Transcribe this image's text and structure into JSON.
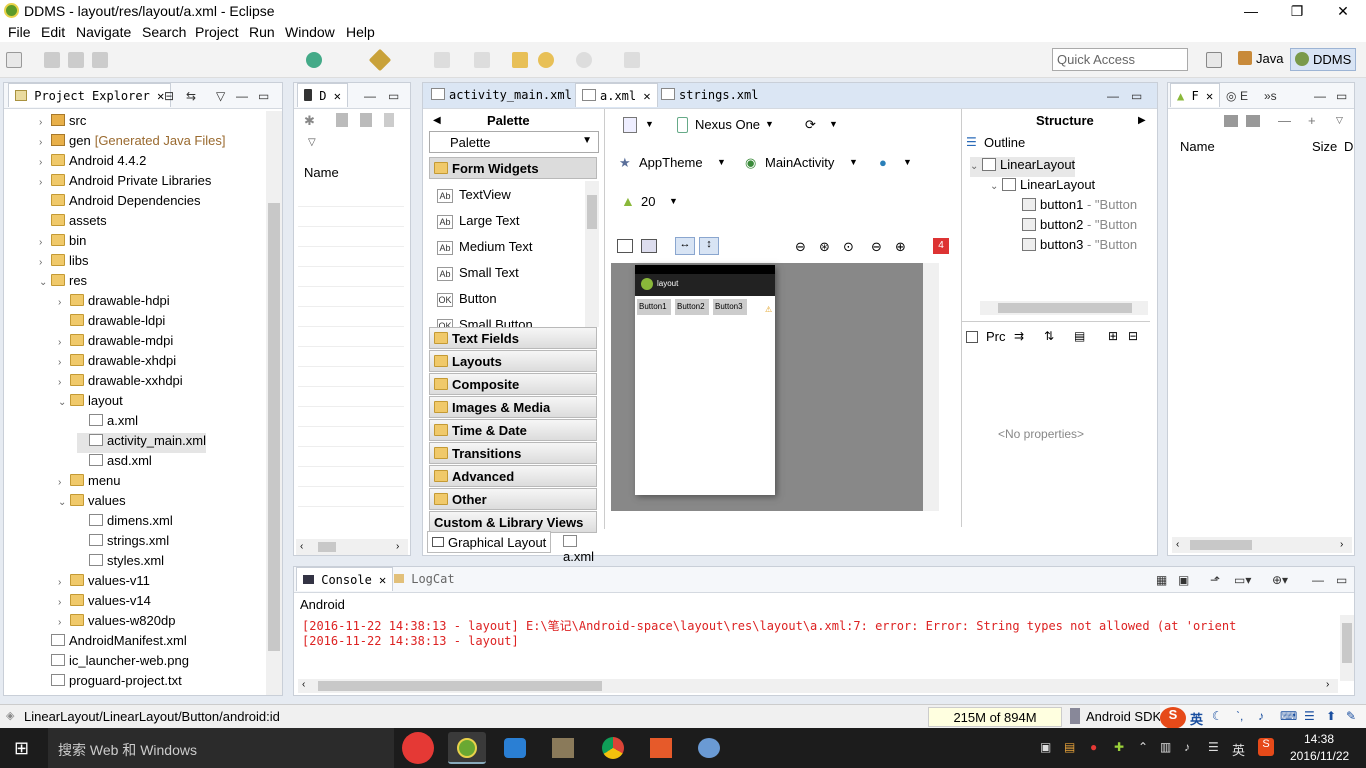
{
  "window": {
    "title": "DDMS - layout/res/layout/a.xml - Eclipse",
    "min": "—",
    "max": "❐",
    "close": "✕"
  },
  "menu": [
    "File",
    "Edit",
    "Navigate",
    "Search",
    "Project",
    "Run",
    "Window",
    "Help"
  ],
  "quick_access": {
    "placeholder": "Quick Access"
  },
  "perspectives": {
    "java": "Java",
    "ddms": "DDMS"
  },
  "project_explorer": {
    "tab": "Project Explorer",
    "items": [
      {
        "label": "src",
        "depth": 1,
        "type": "pkg",
        "open": false
      },
      {
        "label": "gen",
        "extra": "[Generated Java Files]",
        "depth": 1,
        "type": "pkg",
        "open": false
      },
      {
        "label": "Android 4.4.2",
        "depth": 1,
        "type": "lib",
        "open": false
      },
      {
        "label": "Android Private Libraries",
        "depth": 1,
        "type": "lib",
        "open": false
      },
      {
        "label": "Android Dependencies",
        "depth": 1,
        "type": "lib",
        "open": null
      },
      {
        "label": "assets",
        "depth": 1,
        "type": "folder",
        "open": null
      },
      {
        "label": "bin",
        "depth": 1,
        "type": "folder",
        "open": false
      },
      {
        "label": "libs",
        "depth": 1,
        "type": "folder",
        "open": false
      },
      {
        "label": "res",
        "depth": 1,
        "type": "folder",
        "open": true
      },
      {
        "label": "drawable-hdpi",
        "depth": 2,
        "type": "folder",
        "open": false
      },
      {
        "label": "drawable-ldpi",
        "depth": 2,
        "type": "folder",
        "open": null
      },
      {
        "label": "drawable-mdpi",
        "depth": 2,
        "type": "folder",
        "open": false
      },
      {
        "label": "drawable-xhdpi",
        "depth": 2,
        "type": "folder",
        "open": false
      },
      {
        "label": "drawable-xxhdpi",
        "depth": 2,
        "type": "folder",
        "open": false
      },
      {
        "label": "layout",
        "depth": 2,
        "type": "folder",
        "open": true
      },
      {
        "label": "a.xml",
        "depth": 3,
        "type": "file",
        "open": null
      },
      {
        "label": "activity_main.xml",
        "depth": 3,
        "type": "file",
        "open": null,
        "selected": true
      },
      {
        "label": "asd.xml",
        "depth": 3,
        "type": "file",
        "open": null
      },
      {
        "label": "menu",
        "depth": 2,
        "type": "folder",
        "open": false
      },
      {
        "label": "values",
        "depth": 2,
        "type": "folder",
        "open": true
      },
      {
        "label": "dimens.xml",
        "depth": 3,
        "type": "file",
        "open": null
      },
      {
        "label": "strings.xml",
        "depth": 3,
        "type": "file",
        "open": null
      },
      {
        "label": "styles.xml",
        "depth": 3,
        "type": "file",
        "open": null
      },
      {
        "label": "values-v11",
        "depth": 2,
        "type": "folder",
        "open": false
      },
      {
        "label": "values-v14",
        "depth": 2,
        "type": "folder",
        "open": false
      },
      {
        "label": "values-w820dp",
        "depth": 2,
        "type": "folder",
        "open": false
      },
      {
        "label": "AndroidManifest.xml",
        "depth": 1,
        "type": "file",
        "open": null
      },
      {
        "label": "ic_launcher-web.png",
        "depth": 1,
        "type": "file",
        "open": null
      },
      {
        "label": "proguard-project.txt",
        "depth": 1,
        "type": "file",
        "open": null
      }
    ]
  },
  "devices_view": {
    "tab": "D",
    "column": "Name"
  },
  "editor": {
    "tabs": [
      "activity_main.xml",
      "a.xml",
      "strings.xml"
    ],
    "palette": {
      "title": "Palette",
      "dropdown": "Palette",
      "sections_top": [
        "Form Widgets"
      ],
      "widgets": [
        {
          "icon": "Ab",
          "label": "TextView"
        },
        {
          "icon": "Ab",
          "label": "Large Text"
        },
        {
          "icon": "Ab",
          "label": "Medium Text"
        },
        {
          "icon": "Ab",
          "label": "Small Text"
        },
        {
          "icon": "OK",
          "label": "Button"
        },
        {
          "icon": "OK",
          "label": "Small Button"
        }
      ],
      "sections": [
        "Text Fields",
        "Layouts",
        "Composite",
        "Images & Media",
        "Time & Date",
        "Transitions",
        "Advanced",
        "Other",
        "Custom & Library Views"
      ]
    },
    "config": {
      "device": "Nexus One",
      "theme": "AppTheme",
      "activity": "MainActivity",
      "api": "20",
      "errors": "4"
    },
    "preview": {
      "app_title": "layout",
      "buttons": [
        "Button1",
        "Button2",
        "Button3"
      ]
    },
    "bottom_tabs": [
      "Graphical Layout",
      "a.xml"
    ]
  },
  "structure": {
    "title": "Structure",
    "outline": "Outline",
    "tree": [
      {
        "label": "LinearLayout",
        "depth": 0
      },
      {
        "label": "LinearLayout",
        "depth": 1
      },
      {
        "label": "button1",
        "extra": " - \"Button",
        "depth": 2
      },
      {
        "label": "button2",
        "extra": " - \"Button",
        "depth": 2
      },
      {
        "label": "button3",
        "extra": " - \"Button",
        "depth": 2
      }
    ],
    "properties_tab": "Prc",
    "no_properties": "<No properties>"
  },
  "file_explorer": {
    "tab": "F",
    "tab2": "E",
    "more": "»s",
    "columns": [
      "Name",
      "Size",
      "D"
    ]
  },
  "console": {
    "tabs": [
      "Console",
      "LogCat"
    ],
    "title": "Android",
    "lines": [
      "[2016-11-22 14:38:13 - layout] E:\\笔记\\Android-space\\layout\\res\\layout\\a.xml:7: error: Error: String types not allowed (at 'orient",
      "[2016-11-22 14:38:13 - layout]"
    ]
  },
  "status": {
    "path": "LinearLayout/LinearLayout/Button/android:id",
    "memory": "215M of 894M",
    "sdk": "Android SDK"
  },
  "taskbar": {
    "search": "搜索 Web 和 Windows",
    "time": "14:38",
    "date": "2016/11/22",
    "ime": "英"
  },
  "colors": {
    "accent": "#d8e4f4",
    "error_text": "#d22222",
    "taskbar": "#1c1c1c"
  }
}
